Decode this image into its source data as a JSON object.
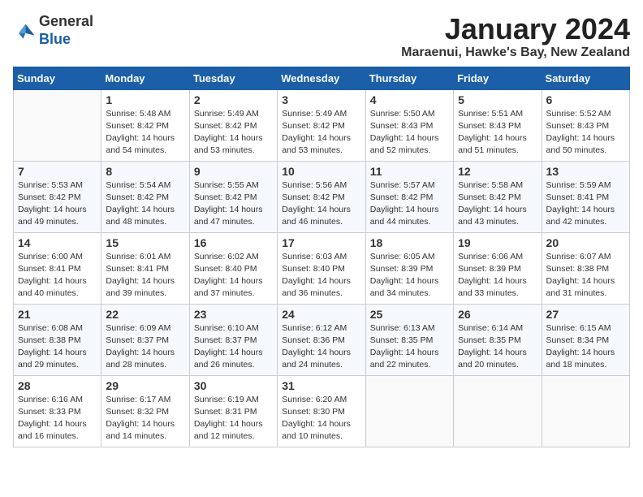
{
  "header": {
    "logo_general": "General",
    "logo_blue": "Blue",
    "month_title": "January 2024",
    "location": "Maraenui, Hawke's Bay, New Zealand"
  },
  "days_of_week": [
    "Sunday",
    "Monday",
    "Tuesday",
    "Wednesday",
    "Thursday",
    "Friday",
    "Saturday"
  ],
  "weeks": [
    [
      {
        "day": "",
        "content": ""
      },
      {
        "day": "1",
        "content": "Sunrise: 5:48 AM\nSunset: 8:42 PM\nDaylight: 14 hours\nand 54 minutes."
      },
      {
        "day": "2",
        "content": "Sunrise: 5:49 AM\nSunset: 8:42 PM\nDaylight: 14 hours\nand 53 minutes."
      },
      {
        "day": "3",
        "content": "Sunrise: 5:49 AM\nSunset: 8:42 PM\nDaylight: 14 hours\nand 53 minutes."
      },
      {
        "day": "4",
        "content": "Sunrise: 5:50 AM\nSunset: 8:43 PM\nDaylight: 14 hours\nand 52 minutes."
      },
      {
        "day": "5",
        "content": "Sunrise: 5:51 AM\nSunset: 8:43 PM\nDaylight: 14 hours\nand 51 minutes."
      },
      {
        "day": "6",
        "content": "Sunrise: 5:52 AM\nSunset: 8:43 PM\nDaylight: 14 hours\nand 50 minutes."
      }
    ],
    [
      {
        "day": "7",
        "content": "Sunrise: 5:53 AM\nSunset: 8:42 PM\nDaylight: 14 hours\nand 49 minutes."
      },
      {
        "day": "8",
        "content": "Sunrise: 5:54 AM\nSunset: 8:42 PM\nDaylight: 14 hours\nand 48 minutes."
      },
      {
        "day": "9",
        "content": "Sunrise: 5:55 AM\nSunset: 8:42 PM\nDaylight: 14 hours\nand 47 minutes."
      },
      {
        "day": "10",
        "content": "Sunrise: 5:56 AM\nSunset: 8:42 PM\nDaylight: 14 hours\nand 46 minutes."
      },
      {
        "day": "11",
        "content": "Sunrise: 5:57 AM\nSunset: 8:42 PM\nDaylight: 14 hours\nand 44 minutes."
      },
      {
        "day": "12",
        "content": "Sunrise: 5:58 AM\nSunset: 8:42 PM\nDaylight: 14 hours\nand 43 minutes."
      },
      {
        "day": "13",
        "content": "Sunrise: 5:59 AM\nSunset: 8:41 PM\nDaylight: 14 hours\nand 42 minutes."
      }
    ],
    [
      {
        "day": "14",
        "content": "Sunrise: 6:00 AM\nSunset: 8:41 PM\nDaylight: 14 hours\nand 40 minutes."
      },
      {
        "day": "15",
        "content": "Sunrise: 6:01 AM\nSunset: 8:41 PM\nDaylight: 14 hours\nand 39 minutes."
      },
      {
        "day": "16",
        "content": "Sunrise: 6:02 AM\nSunset: 8:40 PM\nDaylight: 14 hours\nand 37 minutes."
      },
      {
        "day": "17",
        "content": "Sunrise: 6:03 AM\nSunset: 8:40 PM\nDaylight: 14 hours\nand 36 minutes."
      },
      {
        "day": "18",
        "content": "Sunrise: 6:05 AM\nSunset: 8:39 PM\nDaylight: 14 hours\nand 34 minutes."
      },
      {
        "day": "19",
        "content": "Sunrise: 6:06 AM\nSunset: 8:39 PM\nDaylight: 14 hours\nand 33 minutes."
      },
      {
        "day": "20",
        "content": "Sunrise: 6:07 AM\nSunset: 8:38 PM\nDaylight: 14 hours\nand 31 minutes."
      }
    ],
    [
      {
        "day": "21",
        "content": "Sunrise: 6:08 AM\nSunset: 8:38 PM\nDaylight: 14 hours\nand 29 minutes."
      },
      {
        "day": "22",
        "content": "Sunrise: 6:09 AM\nSunset: 8:37 PM\nDaylight: 14 hours\nand 28 minutes."
      },
      {
        "day": "23",
        "content": "Sunrise: 6:10 AM\nSunset: 8:37 PM\nDaylight: 14 hours\nand 26 minutes."
      },
      {
        "day": "24",
        "content": "Sunrise: 6:12 AM\nSunset: 8:36 PM\nDaylight: 14 hours\nand 24 minutes."
      },
      {
        "day": "25",
        "content": "Sunrise: 6:13 AM\nSunset: 8:35 PM\nDaylight: 14 hours\nand 22 minutes."
      },
      {
        "day": "26",
        "content": "Sunrise: 6:14 AM\nSunset: 8:35 PM\nDaylight: 14 hours\nand 20 minutes."
      },
      {
        "day": "27",
        "content": "Sunrise: 6:15 AM\nSunset: 8:34 PM\nDaylight: 14 hours\nand 18 minutes."
      }
    ],
    [
      {
        "day": "28",
        "content": "Sunrise: 6:16 AM\nSunset: 8:33 PM\nDaylight: 14 hours\nand 16 minutes."
      },
      {
        "day": "29",
        "content": "Sunrise: 6:17 AM\nSunset: 8:32 PM\nDaylight: 14 hours\nand 14 minutes."
      },
      {
        "day": "30",
        "content": "Sunrise: 6:19 AM\nSunset: 8:31 PM\nDaylight: 14 hours\nand 12 minutes."
      },
      {
        "day": "31",
        "content": "Sunrise: 6:20 AM\nSunset: 8:30 PM\nDaylight: 14 hours\nand 10 minutes."
      },
      {
        "day": "",
        "content": ""
      },
      {
        "day": "",
        "content": ""
      },
      {
        "day": "",
        "content": ""
      }
    ]
  ]
}
